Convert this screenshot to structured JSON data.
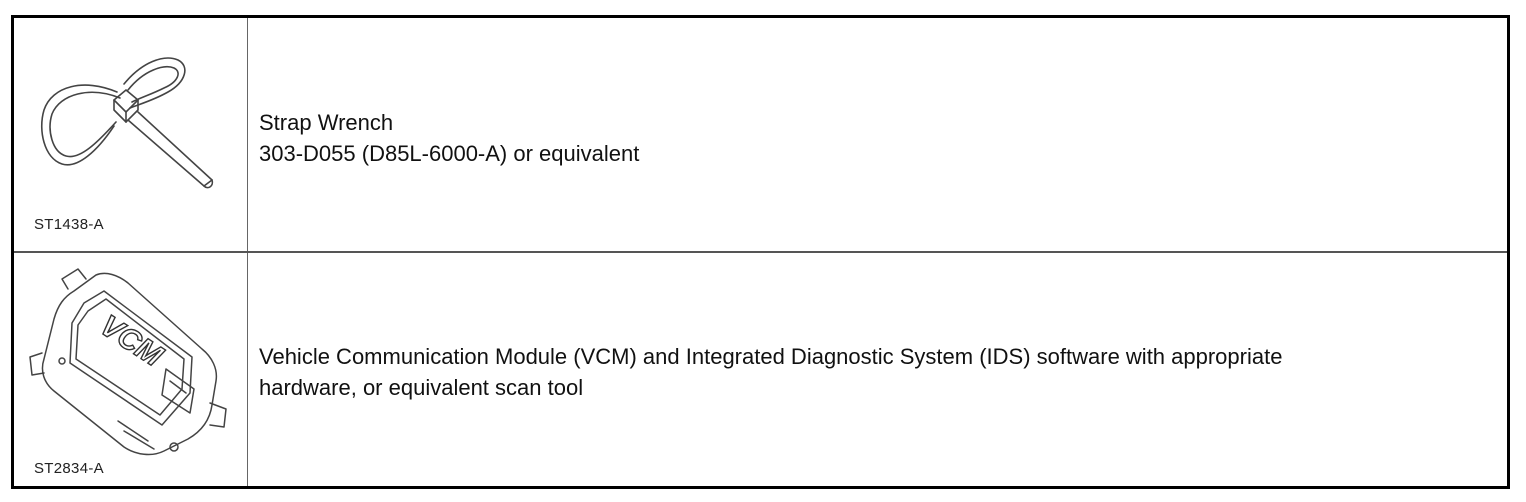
{
  "tools": [
    {
      "code": "ST1438-A",
      "icon": "strap-wrench-icon",
      "description": "Strap Wrench\n303-D055 (D85L-6000-A) or equivalent"
    },
    {
      "code": "ST2834-A",
      "icon": "vcm-module-icon",
      "illustration_label": "VCM",
      "description": "Vehicle Communication Module (VCM) and Integrated Diagnostic System (IDS) software with appropriate\nhardware, or equivalent scan tool"
    }
  ]
}
